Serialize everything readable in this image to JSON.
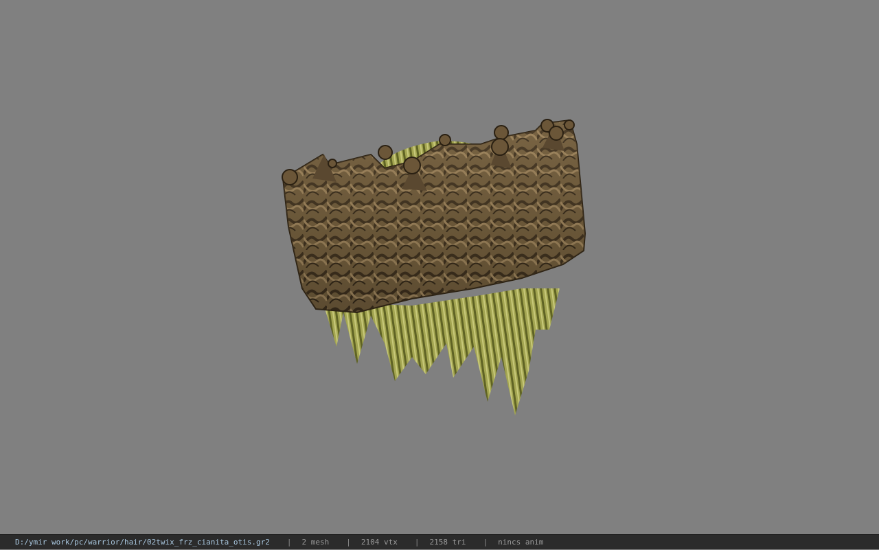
{
  "viewport": {
    "model_icon": "crown-hair-model"
  },
  "statusbar": {
    "file_path": "D:/ymir work/pc/warrior/hair/02twix_frz_cianita_otis.gr2",
    "separator": "|",
    "mesh_count": "2 mesh",
    "vertex_count": "2104 vtx",
    "triangle_count": "2158 tri",
    "anim_status": "nincs anim"
  },
  "colors": {
    "viewport_bg": "#808080",
    "statusbar_bg": "#2b2b2b",
    "path_text": "#a9c7df",
    "info_text": "#9a9a9a"
  }
}
